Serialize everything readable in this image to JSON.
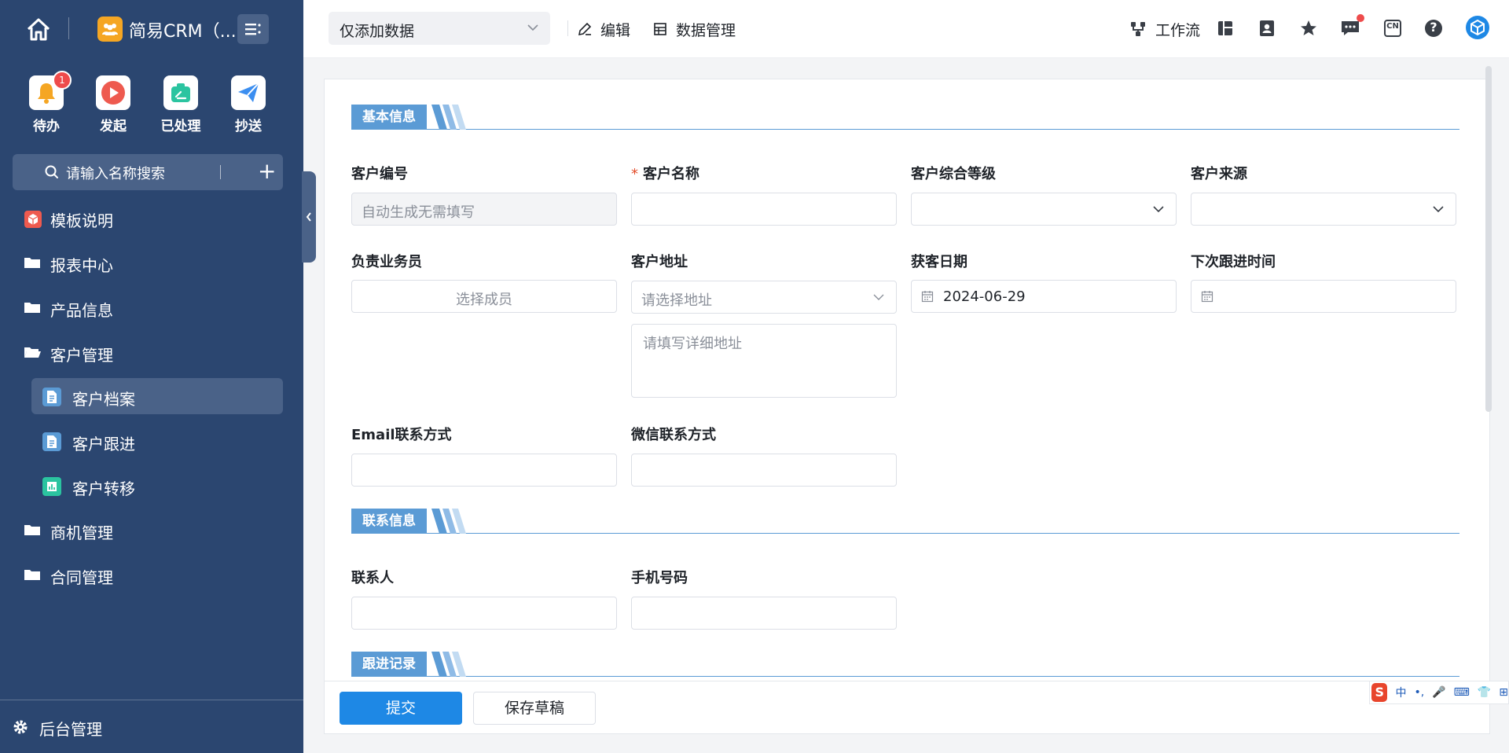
{
  "app": {
    "name": "简易CRM（..."
  },
  "quick_actions": [
    {
      "label": "待办",
      "badge": "1",
      "icon": "bell-icon",
      "color": "#f5a623"
    },
    {
      "label": "发起",
      "icon": "play-icon",
      "color": "#ee5a4f"
    },
    {
      "label": "已处理",
      "icon": "done-icon",
      "color": "#2bc4a0"
    },
    {
      "label": "抄送",
      "icon": "send-icon",
      "color": "#3b8ef0"
    }
  ],
  "sidebar": {
    "search_placeholder": "请输入名称搜索",
    "add_label": "+",
    "items": [
      {
        "label": "模板说明",
        "icon": "template-icon"
      },
      {
        "label": "报表中心",
        "icon": "folder-icon"
      },
      {
        "label": "产品信息",
        "icon": "folder-icon"
      },
      {
        "label": "客户管理",
        "icon": "folder-open-icon"
      },
      {
        "label": "客户档案",
        "icon": "doc-icon",
        "active": true
      },
      {
        "label": "客户跟进",
        "icon": "doc-icon"
      },
      {
        "label": "客户转移",
        "icon": "chart-icon"
      },
      {
        "label": "商机管理",
        "icon": "folder-icon"
      },
      {
        "label": "合同管理",
        "icon": "folder-icon"
      }
    ],
    "bottom_label": "后台管理"
  },
  "header": {
    "view_select": "仅添加数据",
    "edit_label": "编辑",
    "data_manage_label": "数据管理",
    "workflow_label": "工作流",
    "lang_label": "CN",
    "help_label": "?"
  },
  "form": {
    "sections": [
      "基本信息",
      "联系信息",
      "跟进记录"
    ],
    "fields": {
      "customer_no": {
        "label": "客户编号",
        "placeholder": "自动生成无需填写"
      },
      "customer_name": {
        "label": "客户名称",
        "required": "*"
      },
      "customer_level": {
        "label": "客户综合等级"
      },
      "customer_source": {
        "label": "客户来源"
      },
      "salesperson": {
        "label": "负责业务员",
        "placeholder": "选择成员"
      },
      "address": {
        "label": "客户地址",
        "placeholder": "请选择地址",
        "detail_placeholder": "请填写详细地址"
      },
      "acquire_date": {
        "label": "获客日期",
        "value": "2024-06-29"
      },
      "next_followup": {
        "label": "下次跟进时间"
      },
      "email": {
        "label": "Email联系方式"
      },
      "wechat": {
        "label": "微信联系方式"
      },
      "contact": {
        "label": "联系人"
      },
      "phone": {
        "label": "手机号码"
      }
    }
  },
  "actions": {
    "submit": "提交",
    "save_draft": "保存草稿"
  },
  "ime": {
    "logo": "S",
    "items": [
      "中",
      "•,",
      "🎤",
      "⌨",
      "👕",
      "⊞"
    ]
  },
  "colors": {
    "sidebar_bg": "#2b4670",
    "accent": "#1e88e5",
    "section_blue": "#5b9bd5",
    "required_red": "#e34d2b"
  }
}
